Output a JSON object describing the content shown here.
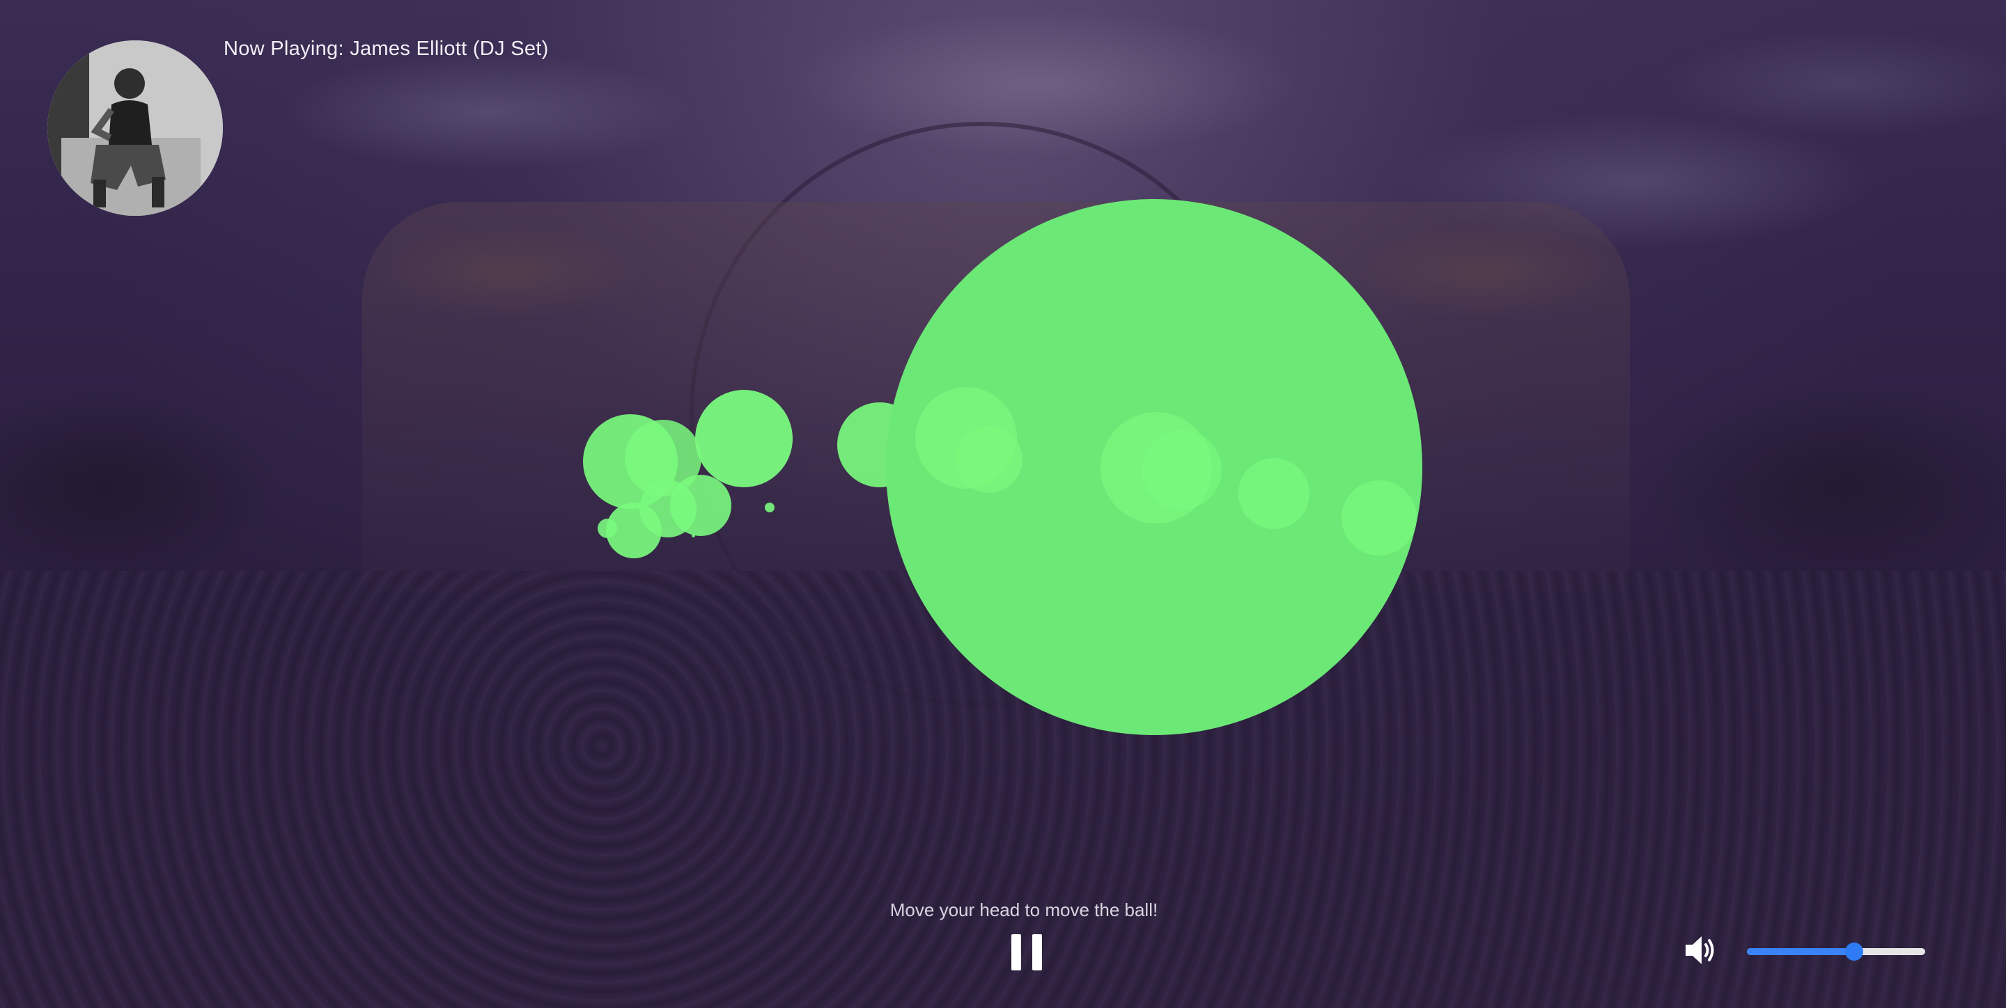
{
  "player": {
    "now_playing_label": "Now Playing: James Elliott (DJ Set)",
    "instruction": "Move your head to move the ball!",
    "state": "playing",
    "volume": 0.6
  },
  "icons": {
    "album_art": "dj-portrait",
    "pause": "pause-icon",
    "volume": "volume-icon"
  },
  "colors": {
    "ball_main": "#6ce876",
    "ball_trail": "#7afa7e",
    "volume_accent": "#2f7bf5",
    "overlay": "#2b1f3f"
  }
}
